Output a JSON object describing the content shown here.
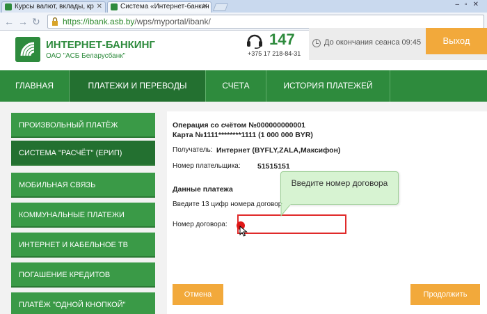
{
  "browser": {
    "tabs": [
      {
        "label": "Курсы валют, вклады, кр"
      },
      {
        "label": "Система «Интернет-банкин"
      }
    ],
    "url_host": "https://ibank.asb.by",
    "url_path": "/wps/myportal/ibank/"
  },
  "header": {
    "brand_name": "ИНТЕРНЕТ-БАНКИНГ",
    "brand_sub": "ОАО \"АСБ Беларусбанк\"",
    "phone_short": "147",
    "phone_full": "+375 17 218-84-31",
    "session_text": "До окончания сеанса 09:45",
    "logout_label": "Выход"
  },
  "mainnav": {
    "items": [
      {
        "label": "ГЛАВНАЯ"
      },
      {
        "label": "ПЛАТЕЖИ И ПЕРЕВОДЫ"
      },
      {
        "label": "СЧЕТА"
      },
      {
        "label": "ИСТОРИЯ ПЛАТЕЖЕЙ"
      }
    ]
  },
  "sidebar": {
    "items": [
      {
        "label": "ПРОИЗВОЛЬНЫЙ ПЛАТЁЖ"
      },
      {
        "label": "СИСТЕМА \"РАСЧЁТ\" (ЕРИП)"
      },
      {
        "label": "МОБИЛЬНАЯ СВЯЗЬ"
      },
      {
        "label": "КОММУНАЛЬНЫЕ ПЛАТЕЖИ"
      },
      {
        "label": "ИНТЕРНЕТ И КАБЕЛЬНОЕ ТВ"
      },
      {
        "label": "ПОГАШЕНИЕ КРЕДИТОВ"
      },
      {
        "label": "ПЛАТЁЖ \"ОДНОЙ КНОПКОЙ\""
      }
    ]
  },
  "content": {
    "operation_line": "Операция со счётом №000000000001",
    "card_line": "Карта №1111********1111  (1 000 000 BYR)",
    "recipient_label": "Получатель:",
    "recipient_value": "Интернет (BYFLY,ZALA,Максифон)",
    "payer_label": "Номер плательщика:",
    "payer_value": "51515151",
    "section_title": "Данные платежа",
    "hint": "Введите 13 цифр номера договора",
    "contract_label": "Номер договора:",
    "contract_value": "",
    "tooltip": "Введите номер договора",
    "cancel_label": "Отмена",
    "continue_label": "Продолжить"
  },
  "colors": {
    "brand_green": "#2e8b3d",
    "active_green": "#237030",
    "accent_orange": "#f2a93b",
    "error_red": "#e02a2a"
  }
}
